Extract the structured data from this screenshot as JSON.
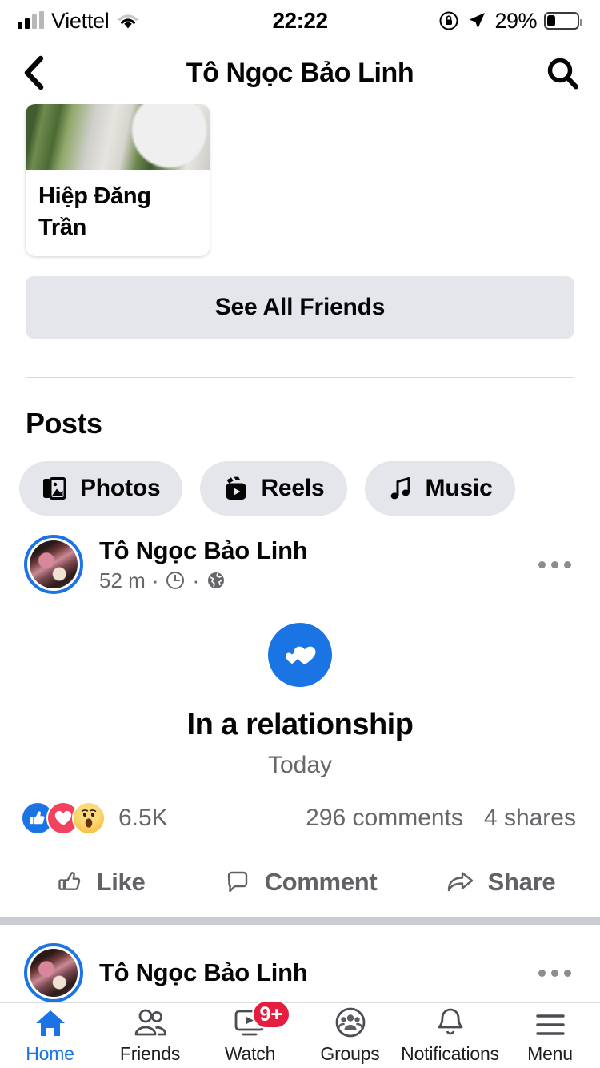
{
  "status_bar": {
    "carrier": "Viettel",
    "time": "22:22",
    "battery_percent": "29%",
    "icons": [
      "signal-bars-icon",
      "wifi-icon",
      "rotation-lock-icon",
      "location-arrow-icon",
      "battery-icon"
    ]
  },
  "header": {
    "title": "Tô Ngọc Bảo Linh",
    "back_icon": "chevron-left-icon",
    "search_icon": "search-icon"
  },
  "friends": {
    "card": {
      "name": "Hiệp Đăng Trần"
    },
    "see_all_label": "See All Friends"
  },
  "posts_section": {
    "title": "Posts",
    "chips": [
      {
        "label": "Photos",
        "icon": "photos-icon"
      },
      {
        "label": "Reels",
        "icon": "reels-icon"
      },
      {
        "label": "Music",
        "icon": "music-note-icon"
      }
    ]
  },
  "post": {
    "author": "Tô Ngọc Bảo Linh",
    "time": "52 m",
    "separator": "·",
    "privacy_icon": "globe-icon",
    "clock_icon": "clock-icon",
    "more_icon": "three-dots-icon",
    "life_event": {
      "icon": "hearts-icon",
      "title": "In a relationship",
      "date": "Today"
    },
    "reactions_count": "6.5K",
    "comments_count": "296 comments",
    "shares_count": "4 shares",
    "actions": [
      {
        "label": "Like",
        "icon": "thumbs-up-icon"
      },
      {
        "label": "Comment",
        "icon": "comment-bubble-icon"
      },
      {
        "label": "Share",
        "icon": "share-arrow-icon"
      }
    ]
  },
  "next_post": {
    "author": "Tô Ngọc Bảo Linh",
    "more_icon": "three-dots-icon"
  },
  "tabbar": [
    {
      "label": "Home",
      "icon": "home-icon",
      "active": true,
      "badge": ""
    },
    {
      "label": "Friends",
      "icon": "friends-icon",
      "active": false,
      "badge": ""
    },
    {
      "label": "Watch",
      "icon": "watch-icon",
      "active": false,
      "badge": "9+"
    },
    {
      "label": "Groups",
      "icon": "groups-icon",
      "active": false,
      "badge": ""
    },
    {
      "label": "Notifications",
      "icon": "bell-icon",
      "active": false,
      "badge": ""
    },
    {
      "label": "Menu",
      "icon": "hamburger-menu-icon",
      "active": false,
      "badge": ""
    }
  ],
  "colors": {
    "accent": "#1B74E4",
    "badge": "#E41E3F",
    "chip_bg": "#E4E6EB",
    "secondary_text": "#65676B"
  }
}
